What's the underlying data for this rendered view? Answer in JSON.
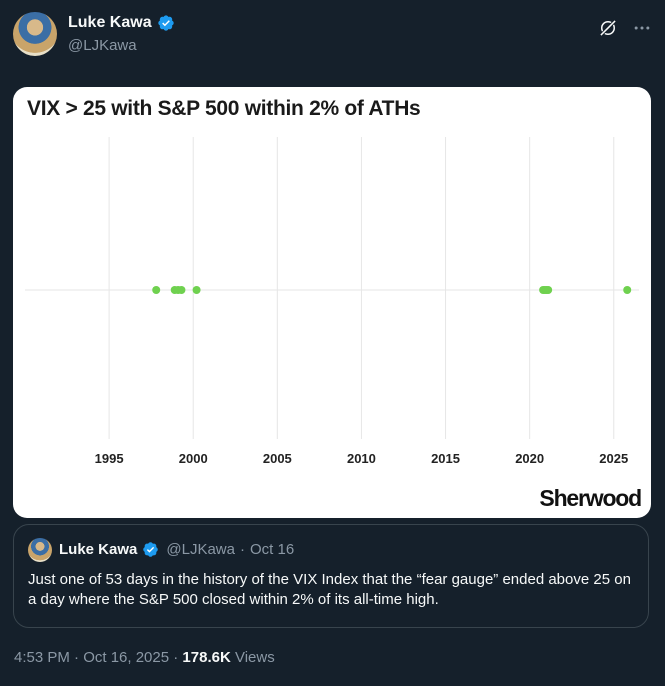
{
  "author": {
    "name": "Luke Kawa",
    "handle": "@LJKawa"
  },
  "header_icons": [
    "grok-icon",
    "more-icon"
  ],
  "chart_data": {
    "type": "scatter",
    "title": "VIX > 25 with S&P 500 within 2% of ATHs",
    "xlabel": "",
    "ylabel": "",
    "xlim": [
      1990,
      2026.5
    ],
    "x_ticks": [
      "1995",
      "2000",
      "2005",
      "2010",
      "2015",
      "2020",
      "2025"
    ],
    "grid": true,
    "series": [
      {
        "color": "#6fd14f",
        "x": [
          1997.8,
          1998.9,
          1999.1,
          1999.3,
          2000.2,
          2020.8,
          2020.9,
          2021.0,
          2021.1,
          2025.8
        ]
      }
    ],
    "brand": "Sherwood"
  },
  "quoted_tweet": {
    "name": "Luke Kawa",
    "handle": "@LJKawa",
    "separator": "·",
    "date": "Oct 16",
    "text": "Just one of 53 days in the history of the VIX Index that the “fear gauge” ended above 25 on a day where the S&P 500 closed within 2% of its all-time high."
  },
  "meta": {
    "timestamp": "4:53 PM · Oct 16, 2025 · ",
    "views_count": "178.6K",
    "views_label": " Views"
  },
  "colors": {
    "background": "#15202b",
    "verified": "#1d9bf0",
    "dot": "#6fd14f"
  }
}
